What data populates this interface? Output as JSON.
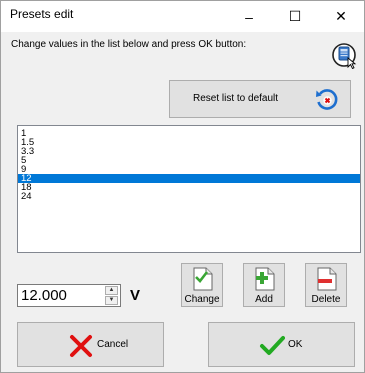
{
  "window": {
    "title": "Presets edit",
    "minimize_glyph": "–",
    "maximize_glyph": "☐",
    "close_glyph": "✕"
  },
  "instruction": "Change values in the list below and press OK button:",
  "reset_button": {
    "label": "Reset list to default",
    "icon": "reset-icon"
  },
  "help_icon": "help-icon",
  "presets": {
    "items": [
      "1",
      "1.5",
      "3.3",
      "5",
      "9",
      "12",
      "18",
      "24"
    ],
    "selected_index": 5
  },
  "value_input": {
    "value": "12.000",
    "unit": "V",
    "up_glyph": "▲",
    "down_glyph": "▼"
  },
  "actions": {
    "change_label": "Change",
    "add_label": "Add",
    "delete_label": "Delete"
  },
  "footer": {
    "cancel_label": "Cancel",
    "ok_label": "OK"
  },
  "colors": {
    "selection": "#0078d7",
    "cancel_red": "#e01010",
    "ok_green": "#22aa22",
    "reset_blue": "#1e6fcf"
  }
}
